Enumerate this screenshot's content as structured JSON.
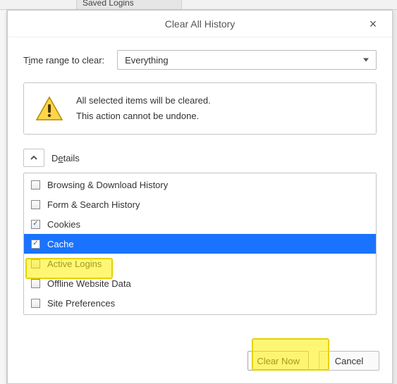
{
  "backdrop": {
    "saved_logins": "Saved Logins"
  },
  "dialog": {
    "title": "Clear All History",
    "close": "×",
    "range": {
      "label_pre": "T",
      "label_u": "i",
      "label_post": "me range to clear:",
      "value": "Everything"
    },
    "warning": {
      "line1": "All selected items will be cleared.",
      "line2": "This action cannot be undone."
    },
    "details": {
      "label_pre": "D",
      "label_u": "e",
      "label_post": "tails"
    },
    "items": [
      {
        "label": "Browsing & Download History",
        "checked": false,
        "selected": false
      },
      {
        "label": "Form & Search History",
        "checked": false,
        "selected": false
      },
      {
        "label": "Cookies",
        "checked": true,
        "selected": false
      },
      {
        "label": "Cache",
        "checked": true,
        "selected": true
      },
      {
        "label": "Active Logins",
        "checked": false,
        "selected": false
      },
      {
        "label": "Offline Website Data",
        "checked": false,
        "selected": false
      },
      {
        "label": "Site Preferences",
        "checked": false,
        "selected": false
      }
    ],
    "buttons": {
      "clear": "Clear Now",
      "cancel": "Cancel"
    }
  }
}
